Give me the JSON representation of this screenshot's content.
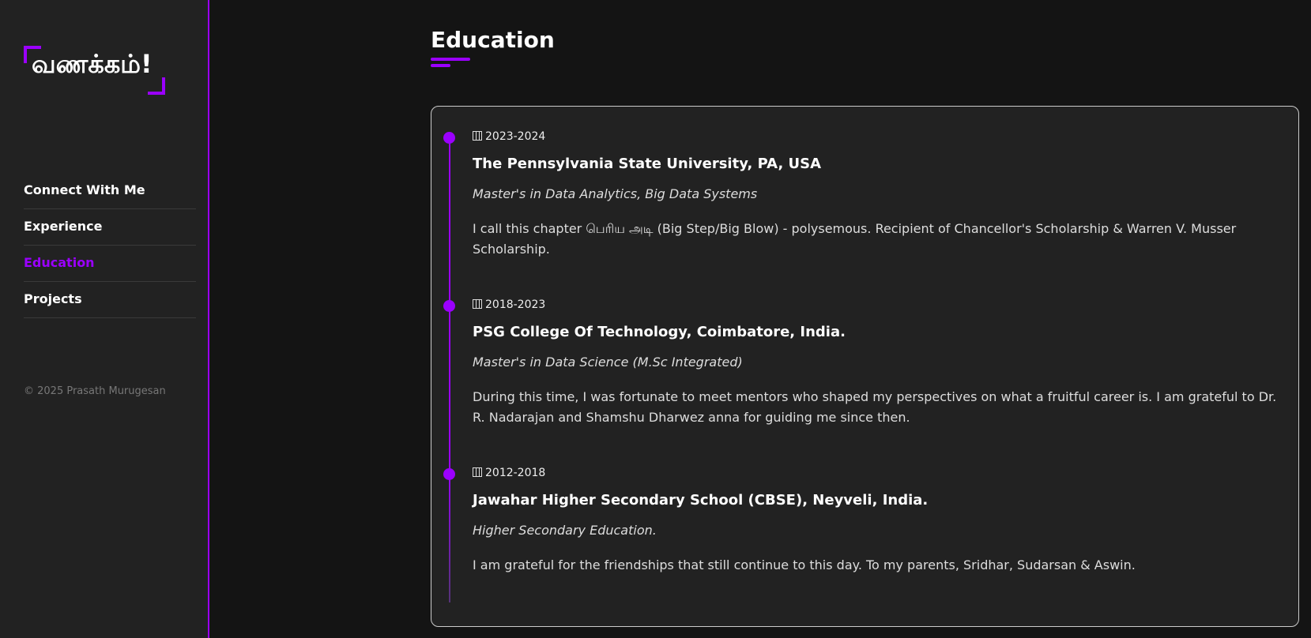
{
  "sidebar": {
    "logo": "வணக்கம்!",
    "nav": [
      {
        "label": "Connect With Me"
      },
      {
        "label": "Experience"
      },
      {
        "label": "Education"
      },
      {
        "label": "Projects"
      }
    ],
    "copyright": "© 2025 Prasath Murugesan"
  },
  "main": {
    "title": "Education",
    "items": [
      {
        "date": "2023-2024",
        "institution": "The Pennsylvania State University, PA, USA",
        "degree": "Master's in Data Analytics, Big Data Systems",
        "description": "I call this chapter பெரிய அடி (Big Step/Big Blow) - polysemous. Recipient of Chancellor's Scholarship & Warren V. Musser Scholarship."
      },
      {
        "date": "2018-2023",
        "institution": "PSG College Of Technology, Coimbatore, India.",
        "degree": "Master's in Data Science (M.Sc Integrated)",
        "description": "During this time, I was fortunate to meet mentors who shaped my perspectives on what a fruitful career is. I am grateful to Dr. R. Nadarajan and Shamshu Dharwez anna for guiding me since then."
      },
      {
        "date": "2012-2018",
        "institution": "Jawahar Higher Secondary School (CBSE), Neyveli, India.",
        "degree": "Higher Secondary Education.",
        "description": "I am grateful for the friendships that still continue to this day. To my parents, Sridhar, Sudarsan & Aswin."
      }
    ]
  },
  "colors": {
    "accent": "#9b00ff"
  }
}
